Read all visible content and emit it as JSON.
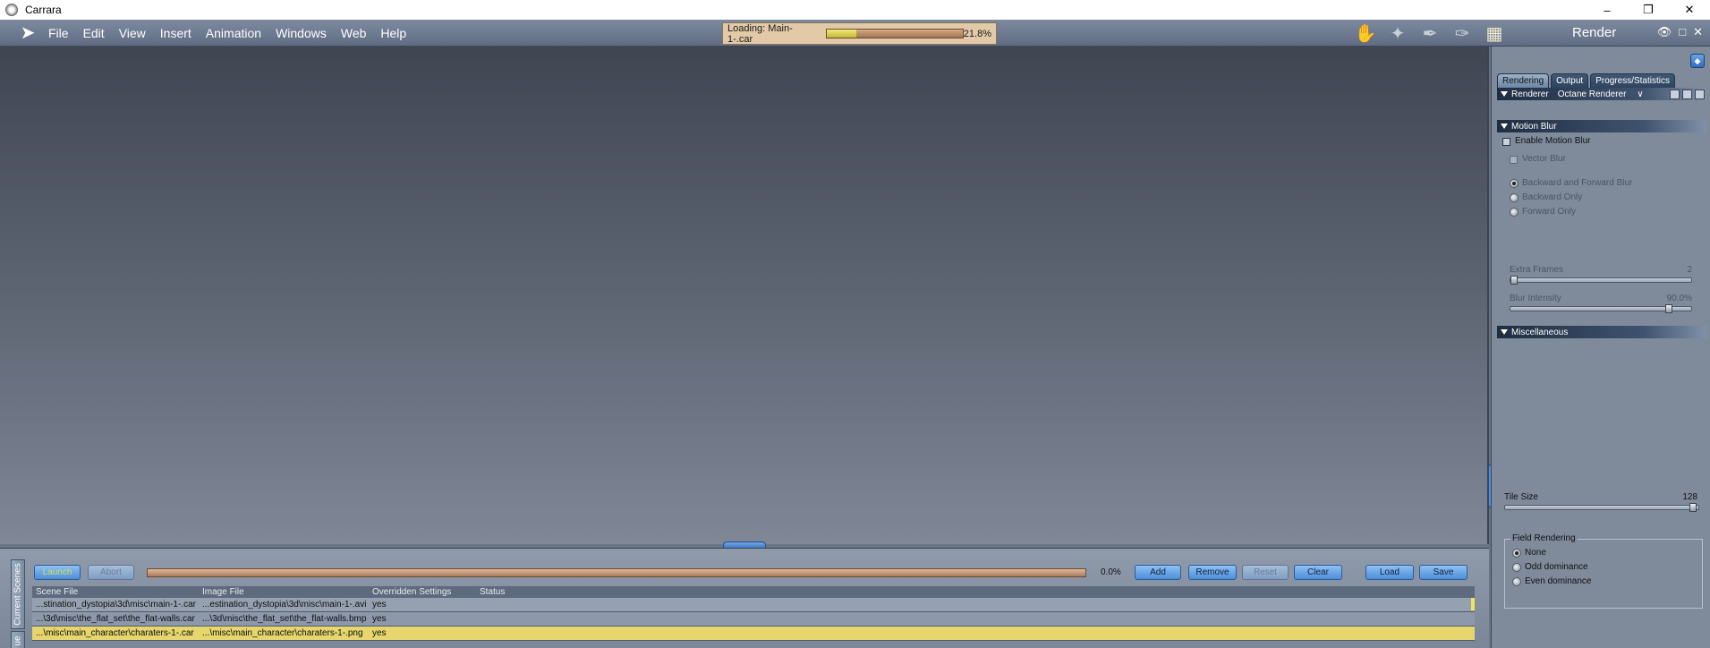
{
  "window": {
    "title": "Carrara",
    "minimize": "–",
    "restore": "❐",
    "close": "✕"
  },
  "menu": {
    "items": [
      "File",
      "Edit",
      "View",
      "Insert",
      "Animation",
      "Windows",
      "Web",
      "Help"
    ]
  },
  "loading": {
    "label": "Loading: Main-1-.car",
    "percent_text": "21.8%",
    "progress": 0.218
  },
  "rooms": {
    "icons": [
      "assemble-room-icon",
      "model-room-icon",
      "storyboard-room-icon",
      "texture-room-icon",
      "render-room-icon"
    ],
    "active_label": "Render"
  },
  "batch_queue": {
    "tabs": [
      "Current Scenes",
      "ue"
    ],
    "buttons": {
      "launch": "Launch",
      "abort": "Abort",
      "add": "Add",
      "remove": "Remove",
      "reset": "Reset",
      "clear": "Clear",
      "load": "Load",
      "save": "Save"
    },
    "progress_text": "0.0%",
    "progress": 0.0,
    "columns": [
      "Scene File",
      "Image File",
      "Overridden Settings",
      "Status"
    ],
    "rows": [
      {
        "scene": "...stination_dystopia\\3d\\misc\\main-1-.car",
        "image": "...estination_dystopia\\3d\\misc\\main-1-.avi",
        "overridden": "yes",
        "status": ""
      },
      {
        "scene": "...\\3d\\misc\\the_flat_set\\the_flat-walls.car",
        "image": "...\\3d\\misc\\the_flat_set\\the_flat-walls.bmp",
        "overridden": "yes",
        "status": ""
      },
      {
        "scene": "...\\misc\\main_character\\charaters-1-.car",
        "image": "...\\misc\\main_character\\charaters-1-.png",
        "overridden": "yes",
        "status": ""
      }
    ]
  },
  "render_panel": {
    "tabs": [
      "Rendering",
      "Output",
      "Progress/Statistics"
    ],
    "renderer": {
      "label": "Renderer",
      "value": "Octane Renderer"
    },
    "motion_blur": {
      "header": "Motion Blur",
      "enable_label": "Enable Motion Blur",
      "vector_blur_label": "Vector Blur",
      "options": [
        "Backward and Forward Blur",
        "Backward Only",
        "Forward Only"
      ],
      "extra_frames_label": "Extra Frames",
      "extra_frames_value": "2",
      "extra_frames_level": 0.0,
      "blur_intensity_label": "Blur Intensity",
      "blur_intensity_value": "90.0%",
      "blur_intensity_level": 0.9
    },
    "miscellaneous": {
      "header": "Miscellaneous",
      "tile_size_label": "Tile Size",
      "tile_size_value": "128",
      "tile_size_level": 1.0,
      "field_rendering": {
        "legend": "Field Rendering",
        "options": [
          "None",
          "Odd dominance",
          "Even dominance"
        ],
        "selected": "None"
      }
    }
  },
  "colors": {
    "accent": "#4c8ed7",
    "selected_row": "#e6d66d",
    "loading_fill": "#c4b832"
  }
}
